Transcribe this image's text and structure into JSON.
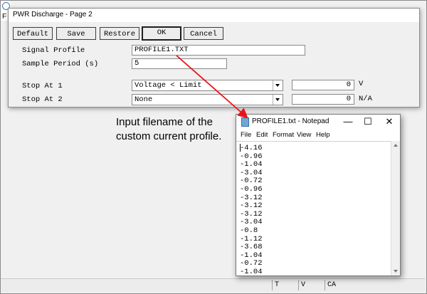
{
  "background_app": {
    "menu_initial": "F",
    "status_cells": [
      "T",
      "V",
      "CA"
    ]
  },
  "dialog": {
    "title": "PWR Discharge - Page 2",
    "buttons": {
      "default": "Default",
      "save": "Save",
      "restore": "Restore",
      "ok": "OK",
      "cancel": "Cancel"
    },
    "signal_profile": {
      "label": "Signal Profile",
      "value": "PROFILE1.TXT"
    },
    "sample_period": {
      "label": "Sample Period (s)",
      "value": "5"
    },
    "stop_at_1": {
      "label": "Stop At 1",
      "selected": "Voltage < Limit",
      "limit": "0",
      "unit": "V"
    },
    "stop_at_2": {
      "label": "Stop At 2",
      "selected": "None",
      "limit": "0",
      "unit": "N/A"
    }
  },
  "annotation": {
    "line1": "Input filename of the",
    "line2": "custom current profile.",
    "arrow_color": "#e8141a"
  },
  "notepad": {
    "title": "PROFILE1.txt - Notepad",
    "controls": {
      "minimize": "—",
      "maximize": "☐",
      "close": "✕"
    },
    "menu": [
      "File",
      "Edit",
      "Format",
      "View",
      "Help"
    ],
    "lines": [
      "-4.16",
      "-0.96",
      "-1.04",
      "-3.04",
      "-0.72",
      "-0.96",
      "-3.12",
      "-3.12",
      "-3.12",
      "-3.04",
      "-0.8",
      "-1.12",
      "-3.68",
      "-1.04",
      "-0.72",
      "-1.04"
    ]
  }
}
